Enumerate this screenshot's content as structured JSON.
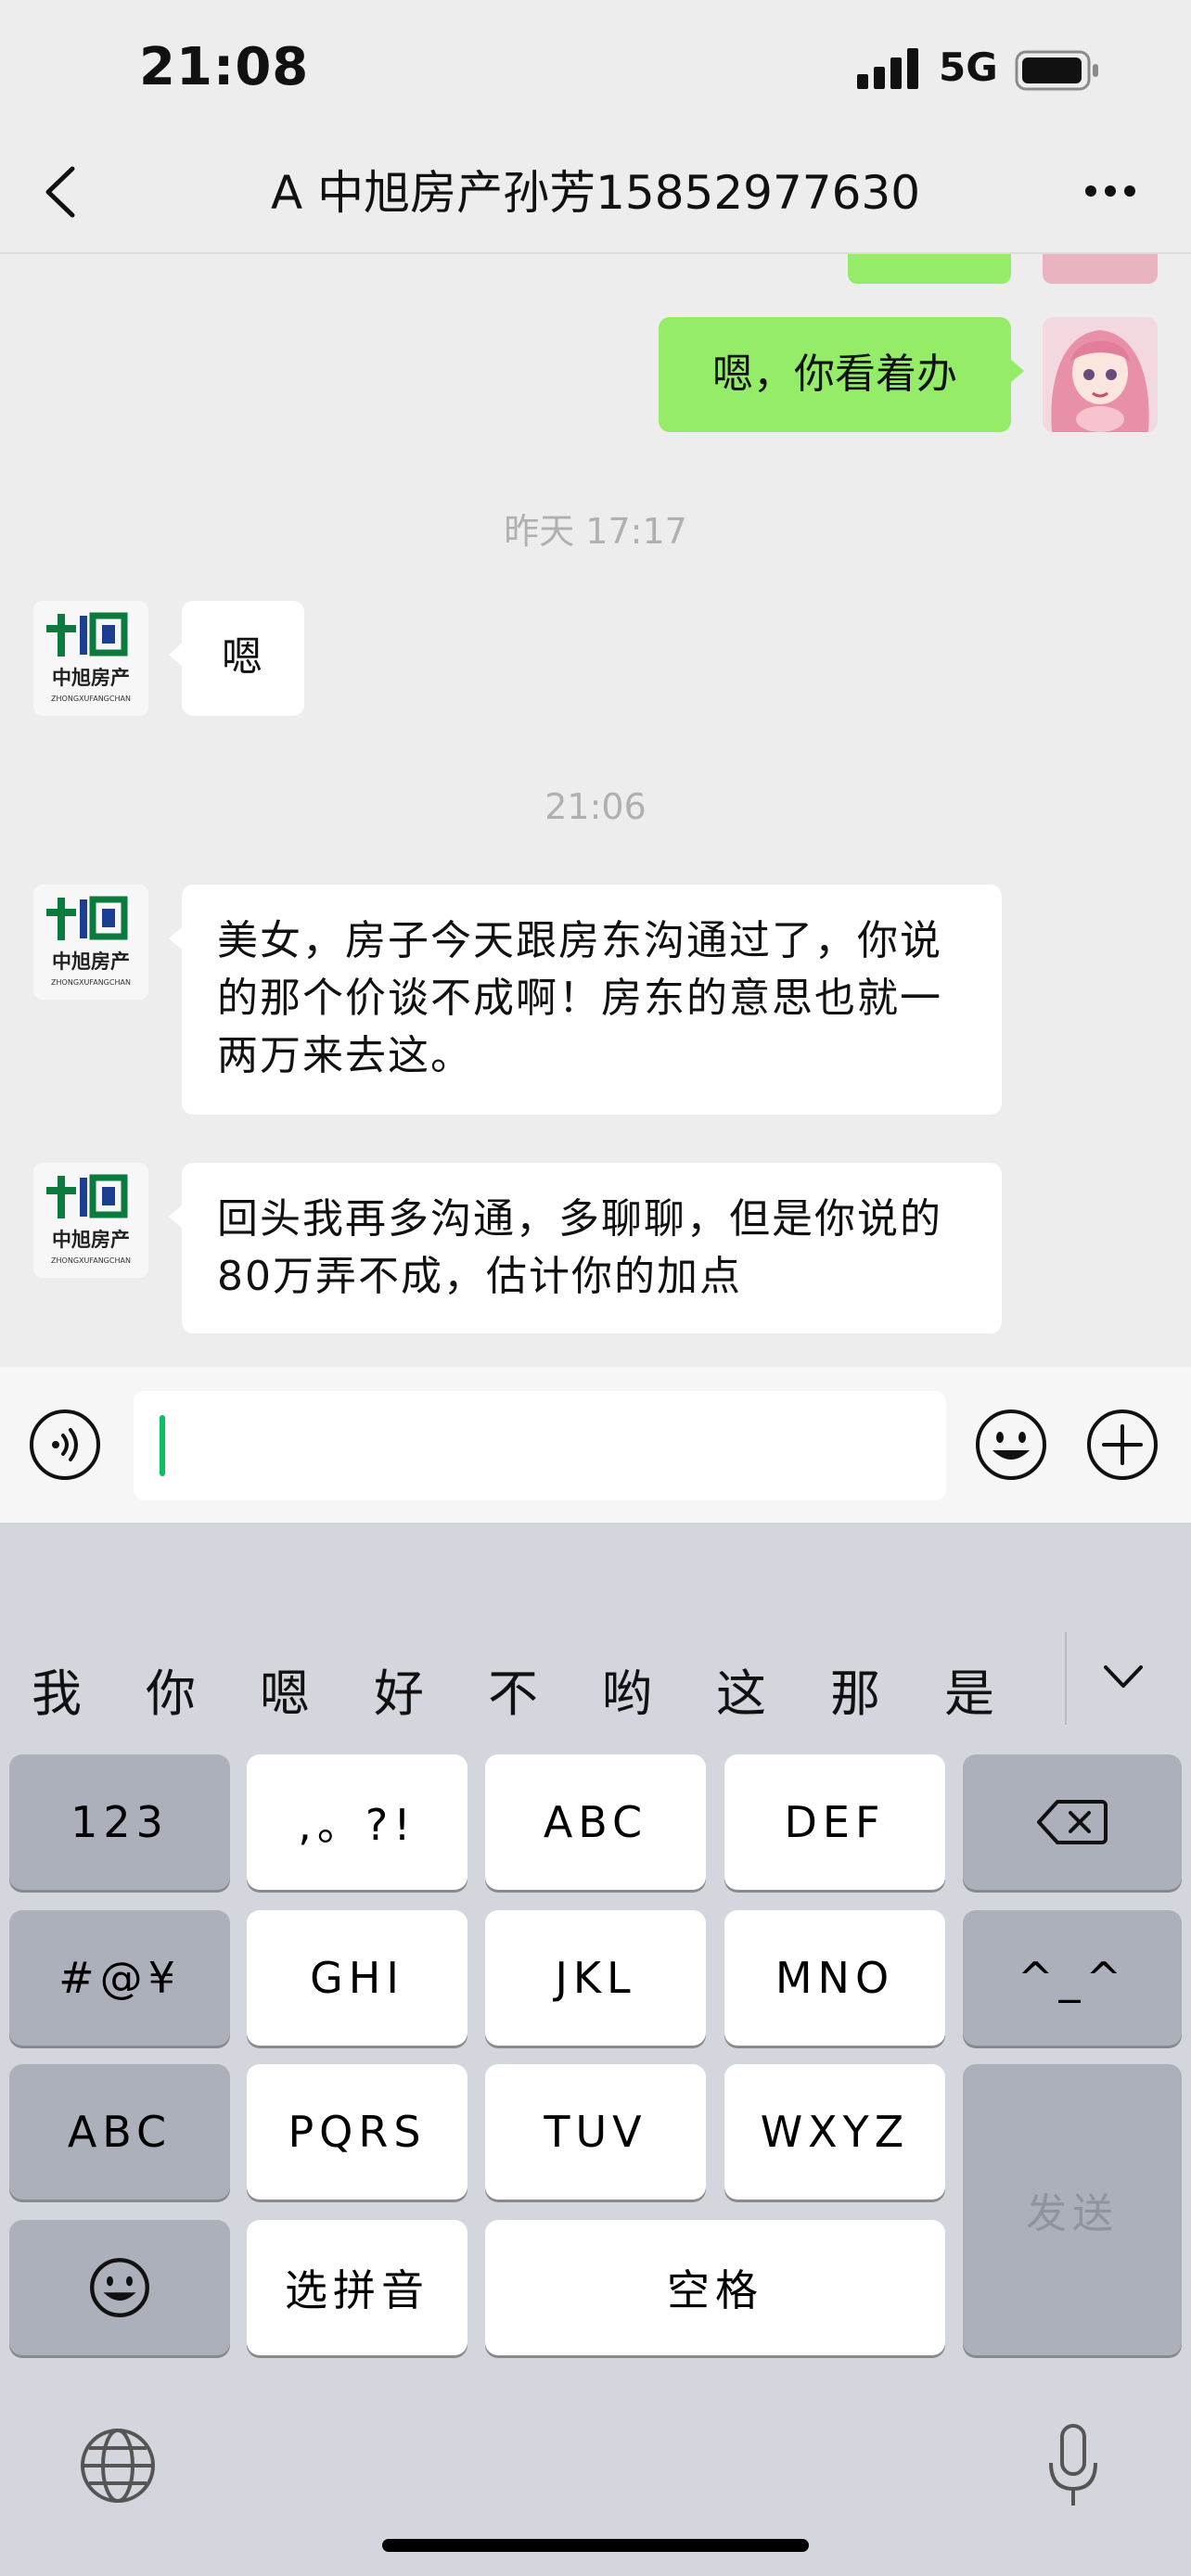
{
  "status_bar": {
    "time": "21:08",
    "network": "5G"
  },
  "nav": {
    "title": "A 中旭房产孙芳15852977630"
  },
  "messages": {
    "me_1": "嗯，你看着办",
    "ts_1": "昨天 17:17",
    "them_1": "嗯",
    "ts_2": "21:06",
    "them_2": "美女，房子今天跟房东沟通过了，你说的那个价谈不成啊！房东的意思也就一两万来去这。",
    "them_3": "回头我再多沟通，多聊聊，但是你说的80万弄不成，估计你的加点"
  },
  "logo": {
    "brand_cn": "中旭房产",
    "brand_pinyin": "ZHONGXUFANGCHAN"
  },
  "keyboard": {
    "candidates": [
      "我",
      "你",
      "嗯",
      "好",
      "不",
      "哟",
      "这",
      "那",
      "是"
    ],
    "keys": {
      "k123": "123",
      "punct": ",。?!",
      "abc": "ABC",
      "def": "DEF",
      "symbols": "#@¥",
      "ghi": "GHI",
      "jkl": "JKL",
      "mno": "MNO",
      "kaomoji": "^_^",
      "abc_switch": "ABC",
      "pqrs": "PQRS",
      "tuv": "TUV",
      "wxyz": "WXYZ",
      "send": "发送",
      "pinyin": "选拼音",
      "space": "空格"
    }
  },
  "colors": {
    "my_bubble": "#95ec69",
    "caret": "#07c160",
    "logo_green": "#0a7a3e",
    "logo_blue": "#1b3e8f"
  },
  "icons": {
    "back": "chevron-left-icon",
    "more": "more-dots-icon",
    "voice": "voice-icon",
    "emoji": "smiley-icon",
    "plus": "plus-circle-icon",
    "backspace": "backspace-icon",
    "globe": "globe-icon",
    "mic": "microphone-icon"
  }
}
